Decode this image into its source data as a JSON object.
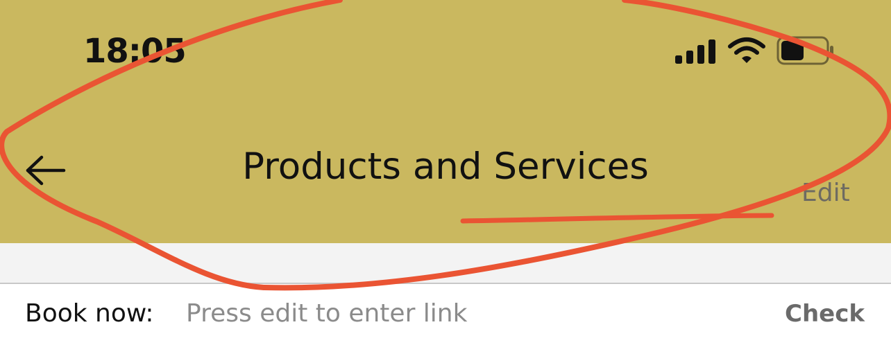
{
  "status_bar": {
    "time": "18:05",
    "icons": [
      "cellular-signal-icon",
      "wifi-icon",
      "battery-icon"
    ]
  },
  "header": {
    "back_icon": "left-arrow-icon",
    "title": "Products and Services",
    "edit_label": "Edit"
  },
  "link_row": {
    "label": "Book now:",
    "placeholder": "Press edit to enter link",
    "action_label": "Check"
  },
  "colors": {
    "header_background": "#cab85f",
    "annotation_stroke": "#ea5433",
    "subheader_background": "#f3f3f3"
  }
}
